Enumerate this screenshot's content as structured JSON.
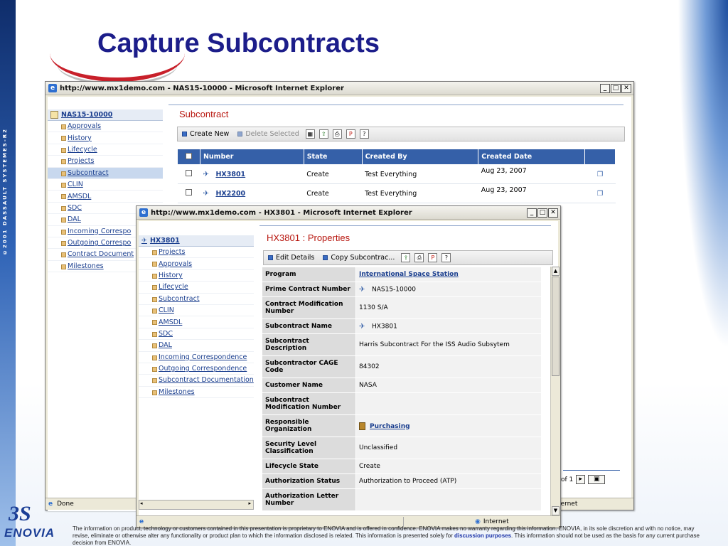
{
  "slide": {
    "title": "Capture Subcontracts",
    "side_text": "©2001 DASSAULT SYSTEMES-R2",
    "logo_text": "ENOVIA",
    "footer_part1": "The information on product, technology or customers contained in this presentation is proprietary to ENOVIA and is offered in confidence. ENOVIA makes no warranty regarding this information. ENOVIA, in its sole discretion and with no notice, may revise, eliminate or otherwise alter any functionality or product plan to which the information disclosed is related. This information is presented solely for ",
    "footer_link": "discussion purposes",
    "footer_part2": ". This information should not be used as the basis for any current purchase decision from ENOVIA."
  },
  "back_window": {
    "title": "http://www.mx1demo.com - NAS15-10000 - Microsoft Internet Explorer",
    "nav_head": "NAS15-10000",
    "nav_items": [
      "Approvals",
      "History",
      "Lifecycle",
      "Projects",
      "Subcontract",
      "CLIN",
      "AMSDL",
      "SDC",
      "DAL",
      "Incoming Correspo",
      "Outgoing Correspo",
      "Contract Document",
      "Milestones"
    ],
    "active_nav": "Subcontract",
    "page_title": "Subcontract",
    "toolbar": {
      "create_new": "Create New",
      "delete_selected": "Delete Selected"
    },
    "table": {
      "columns": [
        "Number",
        "State",
        "Created By",
        "Created Date"
      ],
      "rows": [
        {
          "number": "HX3801",
          "state": "Create",
          "created_by": "Test Everything",
          "created_date": "Aug 23, 2007"
        },
        {
          "number": "HX2200",
          "state": "Create",
          "created_by": "Test Everything",
          "created_date": "Aug 23, 2007"
        }
      ]
    },
    "pager_text": "of 1",
    "status": "Done",
    "status_zone": "ternet"
  },
  "front_window": {
    "title": "http://www.mx1demo.com - HX3801 - Microsoft Internet Explorer",
    "nav_head": "HX3801",
    "nav_items": [
      "Projects",
      "Approvals",
      "History",
      "Lifecycle",
      "Subcontract",
      "CLIN",
      "AMSDL",
      "SDC",
      "DAL",
      "Incoming Correspondence",
      "Outgoing Correspondence",
      "Subcontract Documentation",
      "Milestones"
    ],
    "page_title": "HX3801 : Properties",
    "toolbar": {
      "edit_details": "Edit Details",
      "copy_subcontract": "Copy Subcontrac..."
    },
    "properties": [
      {
        "label": "Program",
        "value": "International Space Station",
        "link": true
      },
      {
        "label": "Prime Contract Number",
        "value": "NAS15-10000",
        "icon": true
      },
      {
        "label": "Contract Modification Number",
        "value": "1130 S/A"
      },
      {
        "label": "Subcontract Name",
        "value": "HX3801",
        "icon": true
      },
      {
        "label": "Subcontract Description",
        "value": "Harris Subcontract For the ISS Audio Subsytem"
      },
      {
        "label": "Subcontractor CAGE Code",
        "value": "84302"
      },
      {
        "label": "Customer Name",
        "value": "NASA"
      },
      {
        "label": "Subcontract Modification Number",
        "value": ""
      },
      {
        "label": "Responsible Organization",
        "value": "Purchasing",
        "link": true,
        "org_icon": true
      },
      {
        "label": "Security Level Classification",
        "value": "Unclassified"
      },
      {
        "label": "Lifecycle State",
        "value": "Create"
      },
      {
        "label": "Authorization Status",
        "value": "Authorization to Proceed (ATP)"
      },
      {
        "label": "Authorization Letter Number",
        "value": ""
      }
    ],
    "status_zone": "Internet"
  }
}
